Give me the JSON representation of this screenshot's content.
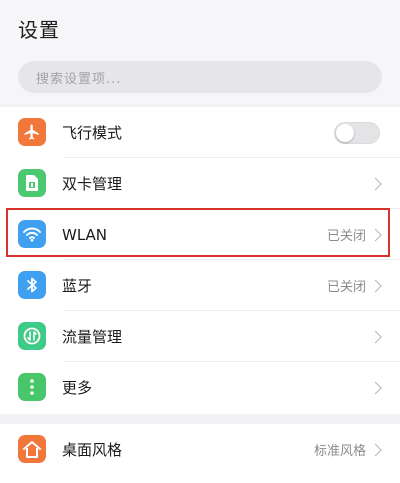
{
  "header": {
    "title": "设置"
  },
  "search": {
    "placeholder": "搜索设置项..."
  },
  "settings": [
    {
      "label": "飞行模式",
      "icon": "airplane-icon",
      "color": "#f2773a",
      "control": "toggle",
      "toggle_on": false
    },
    {
      "label": "双卡管理",
      "icon": "sim-card-icon",
      "color": "#4cc870",
      "control": "chevron"
    },
    {
      "label": "WLAN",
      "icon": "wifi-icon",
      "color": "#3f9ff0",
      "control": "chevron",
      "value": "已关闭"
    },
    {
      "label": "蓝牙",
      "icon": "bluetooth-icon",
      "color": "#3f9ff0",
      "control": "chevron",
      "value": "已关闭"
    },
    {
      "label": "流量管理",
      "icon": "data-usage-icon",
      "color": "#3ecb88",
      "control": "chevron"
    },
    {
      "label": "更多",
      "icon": "more-icon",
      "color": "#47c76a",
      "control": "chevron"
    }
  ],
  "settings2": [
    {
      "label": "桌面风格",
      "icon": "home-icon",
      "color": "#f2773a",
      "control": "chevron",
      "value": "标准风格"
    }
  ],
  "highlight_color": "#d9342b"
}
